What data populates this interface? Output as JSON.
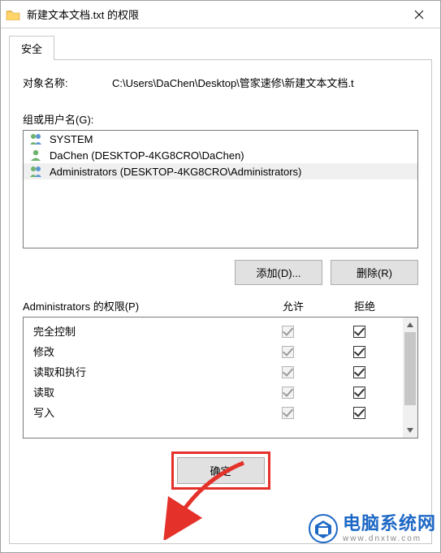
{
  "title": "新建文本文档.txt 的权限",
  "tab_label": "安全",
  "object_label": "对象名称:",
  "object_value": "C:\\Users\\DaChen\\Desktop\\管家速修\\新建文本文档.t",
  "groups_label": "组或用户名(G):",
  "users": [
    {
      "name": "SYSTEM",
      "type": "group",
      "selected": false
    },
    {
      "name": "DaChen (DESKTOP-4KG8CRO\\DaChen)",
      "type": "user",
      "selected": false
    },
    {
      "name": "Administrators (DESKTOP-4KG8CRO\\Administrators)",
      "type": "group",
      "selected": true
    }
  ],
  "buttons": {
    "add": "添加(D)...",
    "remove": "删除(R)",
    "ok": "确定"
  },
  "perm_header_label": "Administrators 的权限(P)",
  "col_allow": "允许",
  "col_deny": "拒绝",
  "permissions": [
    {
      "name": "完全控制",
      "allow": true,
      "deny": true
    },
    {
      "name": "修改",
      "allow": true,
      "deny": true
    },
    {
      "name": "读取和执行",
      "allow": true,
      "deny": true
    },
    {
      "name": "读取",
      "allow": true,
      "deny": true
    },
    {
      "name": "写入",
      "allow": true,
      "deny": true
    }
  ],
  "watermark": {
    "cn": "电脑系统网",
    "en": "www.dnxtw.com"
  }
}
